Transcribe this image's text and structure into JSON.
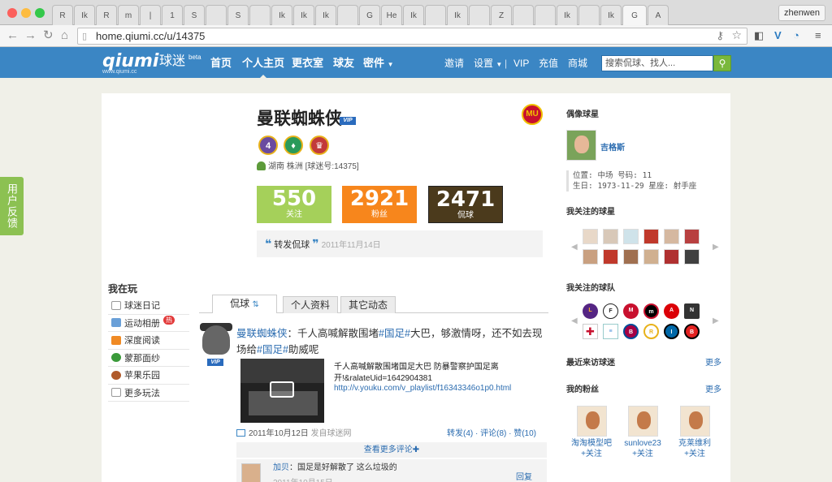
{
  "browser": {
    "tabs": [
      "R",
      "Ik",
      "R",
      "m",
      "|",
      "1",
      "S",
      "",
      "S",
      "",
      "Ik",
      "Ik",
      "Ik",
      "",
      "G",
      "He",
      "Ik",
      "",
      "Ik",
      "",
      "Z",
      "",
      "",
      "Ik",
      "",
      "Ik",
      "G",
      "A"
    ],
    "active_tab": "",
    "user": "zhenwen",
    "url": "home.qiumi.cc/u/14375"
  },
  "site": {
    "logo": "qiumi",
    "logo_cn": "球迷",
    "logo_beta": "beta",
    "logo_sub": "www.qiumi.cc",
    "nav": [
      "首页",
      "个人主页",
      "更衣室",
      "球友",
      "密件"
    ],
    "nav_right": [
      "邀请",
      "设置",
      "VIP",
      "充值",
      "商城"
    ],
    "search_placeholder": "搜索侃球、找人...",
    "brand_color": "#3b86c4"
  },
  "feedback": "用户反馈",
  "profile": {
    "name": "曼联蜘蛛侠",
    "vip": "VIP",
    "location": "湖南 株洲",
    "qiumi_id": "[球迷号:14375]",
    "stats": [
      {
        "num": "550",
        "label": "关注",
        "color": "#a5d05a"
      },
      {
        "num": "2921",
        "label": "粉丝",
        "color": "#f7861c"
      },
      {
        "num": "2471",
        "label": "侃球",
        "color": "#4b3a1c"
      }
    ],
    "quote_label": "转发侃球",
    "quote_date": "2011年11月14日"
  },
  "left": {
    "title": "我在玩",
    "items": [
      "球迷日记",
      "运动相册",
      "深度阅读",
      "蒙那面纱",
      "苹果乐园",
      "更多玩法"
    ],
    "badge": "热"
  },
  "feed": {
    "tabs": [
      "侃球",
      "个人资料",
      "其它动态"
    ],
    "post": {
      "user": "曼联蜘蛛侠",
      "text1": "：千人高喊解散围堵",
      "tag1": "#国足#",
      "text2": "大巴，够激情呀，还不如去现场给",
      "tag2": "#国足#",
      "text3": "助威呢",
      "video_title": "千人高喊解散围堵国足大巴 防暴警察护国足离开!&ralateUid=1642904381",
      "video_url": "http://v.youku.com/v_playlist/f16343346o1p0.html",
      "date": "2011年10月12日",
      "source": "发自球迷网",
      "actions": "转发(4) · 评论(8) · 赞(10)",
      "more_comments": "查看更多评论✚"
    },
    "comment": {
      "user": "加贝",
      "text": "：国足是好解散了 这么垃圾的",
      "date": "2011年10月15日",
      "reply": "回复"
    }
  },
  "right": {
    "idol_title": "偶像球星",
    "idol_name": "吉格斯",
    "idol_info": [
      "位置: 中场        号码: 11",
      "生日: 1973-11-29 星座: 射手座"
    ],
    "stars_title": "我关注的球星",
    "teams_title": "我关注的球队",
    "visitors_title": "最近来访球迷",
    "fans_title": "我的粉丝",
    "more": "更多",
    "fans": [
      {
        "name": "淘淘模型吧",
        "follow": "+关注"
      },
      {
        "name": "sunlove23",
        "follow": "+关注"
      },
      {
        "name": "克莱维利",
        "follow": "+关注"
      }
    ]
  }
}
